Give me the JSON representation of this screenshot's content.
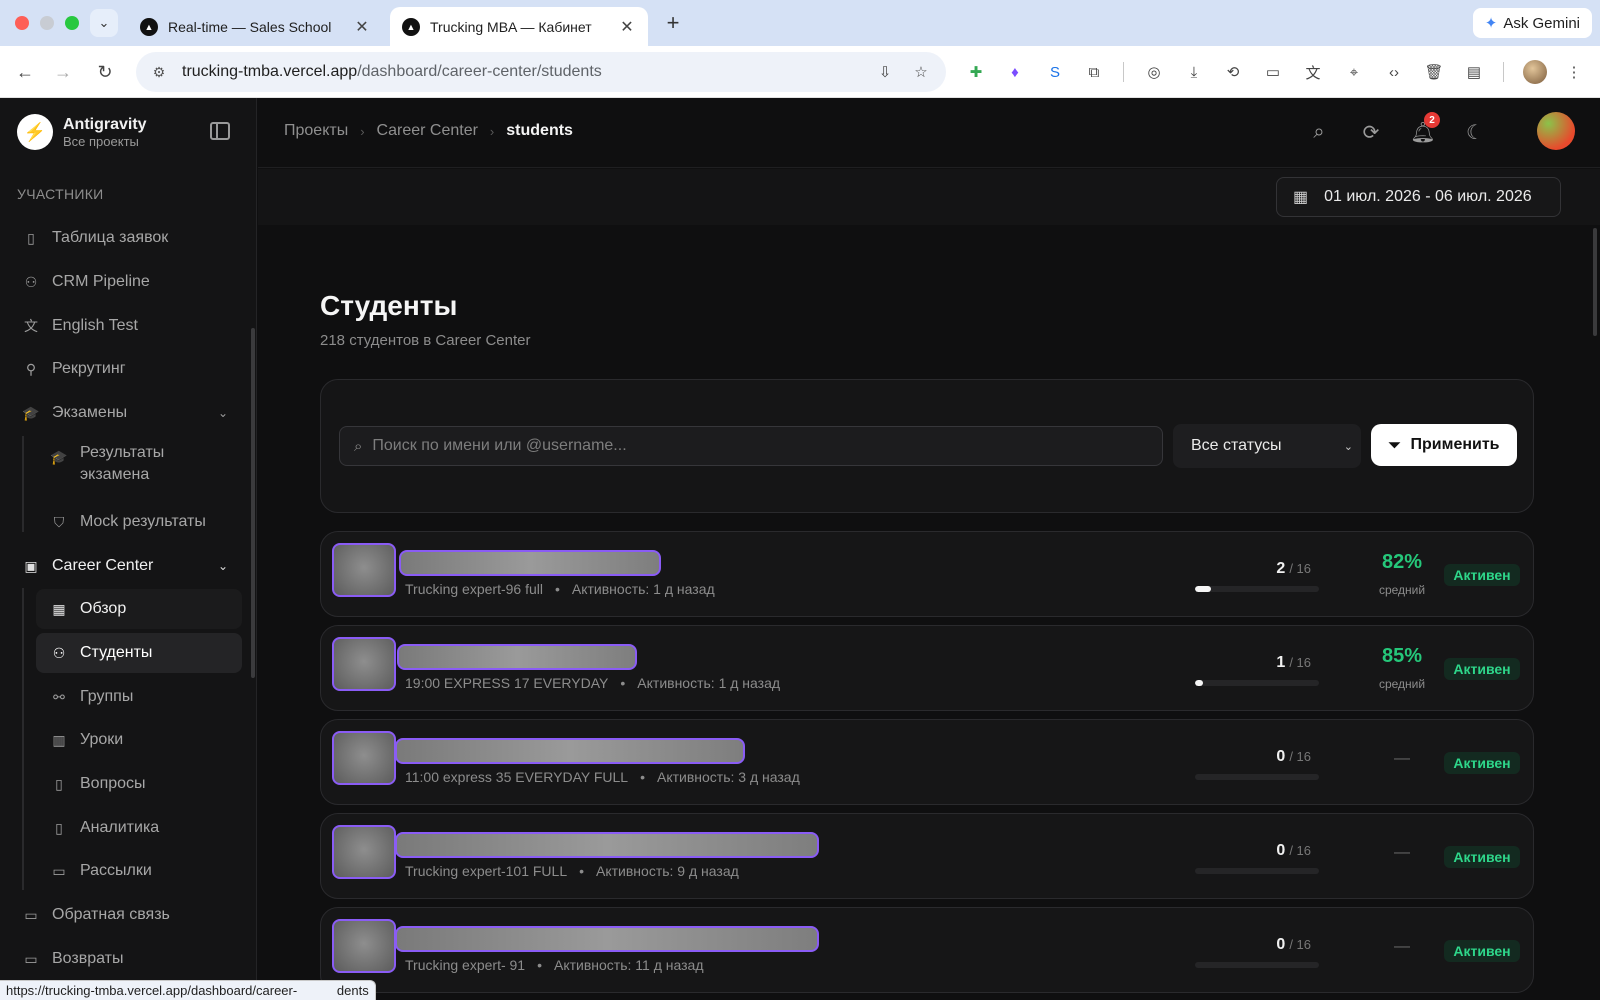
{
  "browser": {
    "tabs": [
      {
        "title": "Real-time — Sales School",
        "active": false
      },
      {
        "title": "Trucking MBA — Кабинет",
        "active": true
      }
    ],
    "ask_gemini": "Ask Gemini",
    "url_host": "trucking-tmba.vercel.app",
    "url_path": "/dashboard/career-center/students",
    "status_url": "https://trucking-tmba.vercel.app/dashboard/career-           dents"
  },
  "sidebar": {
    "brand_name": "Antigravity",
    "brand_sub": "Все проекты",
    "section_label": "УЧАСТНИКИ",
    "items": [
      {
        "label": "Таблица заявок",
        "icon": "document-icon"
      },
      {
        "label": "CRM Pipeline",
        "icon": "users-icon"
      },
      {
        "label": "English Test",
        "icon": "translate-icon"
      },
      {
        "label": "Рекрутинг",
        "icon": "user-plus-icon"
      },
      {
        "label": "Экзамены",
        "icon": "graduation-cap-icon"
      },
      {
        "label": "Результаты экзамена",
        "icon": "graduation-cap-icon"
      },
      {
        "label": "Mock результаты",
        "icon": "shield-icon"
      },
      {
        "label": "Career Center",
        "icon": "briefcase-icon"
      },
      {
        "label": "Обзор",
        "icon": "dashboard-icon"
      },
      {
        "label": "Студенты",
        "icon": "users-icon"
      },
      {
        "label": "Группы",
        "icon": "hierarchy-icon"
      },
      {
        "label": "Уроки",
        "icon": "book-icon"
      },
      {
        "label": "Вопросы",
        "icon": "document-icon"
      },
      {
        "label": "Аналитика",
        "icon": "chart-file-icon"
      },
      {
        "label": "Рассылки",
        "icon": "message-icon"
      },
      {
        "label": "Обратная связь",
        "icon": "message-icon"
      },
      {
        "label": "Возвраты",
        "icon": "message-icon"
      }
    ]
  },
  "header": {
    "breadcrumbs": [
      "Проекты",
      "Career Center",
      "students"
    ],
    "notification_count": "2",
    "date_range": "01 июл. 2026 - 06 июл. 2026"
  },
  "page": {
    "title": "Студенты",
    "subtitle": "218 студентов в Career Center"
  },
  "filters": {
    "search_placeholder": "Поиск по имени или @username...",
    "status_value": "Все статусы",
    "apply_label": "Применить"
  },
  "students": [
    {
      "group": "Trucking expert-96 full",
      "activity": "Активность: 1 д назад",
      "done": "2",
      "total": "/ 16",
      "progress": 0.125,
      "score": "82%",
      "score_label": "средний",
      "status": "Активен"
    },
    {
      "group": "19:00 EXPRESS 17 EVERYDAY",
      "activity": "Активность: 1 д назад",
      "done": "1",
      "total": "/ 16",
      "progress": 0.0625,
      "score": "85%",
      "score_label": "средний",
      "status": "Активен"
    },
    {
      "group": "11:00 express 35 EVERYDAY FULL",
      "activity": "Активность: 3 д назад",
      "done": "0",
      "total": "/ 16",
      "progress": 0,
      "score": "—",
      "score_label": "",
      "status": "Активен"
    },
    {
      "group": "Trucking expert-101 FULL",
      "activity": "Активность: 9 д назад",
      "done": "0",
      "total": "/ 16",
      "progress": 0,
      "score": "—",
      "score_label": "",
      "status": "Активен"
    },
    {
      "group": "Trucking expert- 91",
      "activity": "Активность: 11 д назад",
      "done": "0",
      "total": "/ 16",
      "progress": 0,
      "score": "—",
      "score_label": "",
      "status": "Активен"
    }
  ]
}
